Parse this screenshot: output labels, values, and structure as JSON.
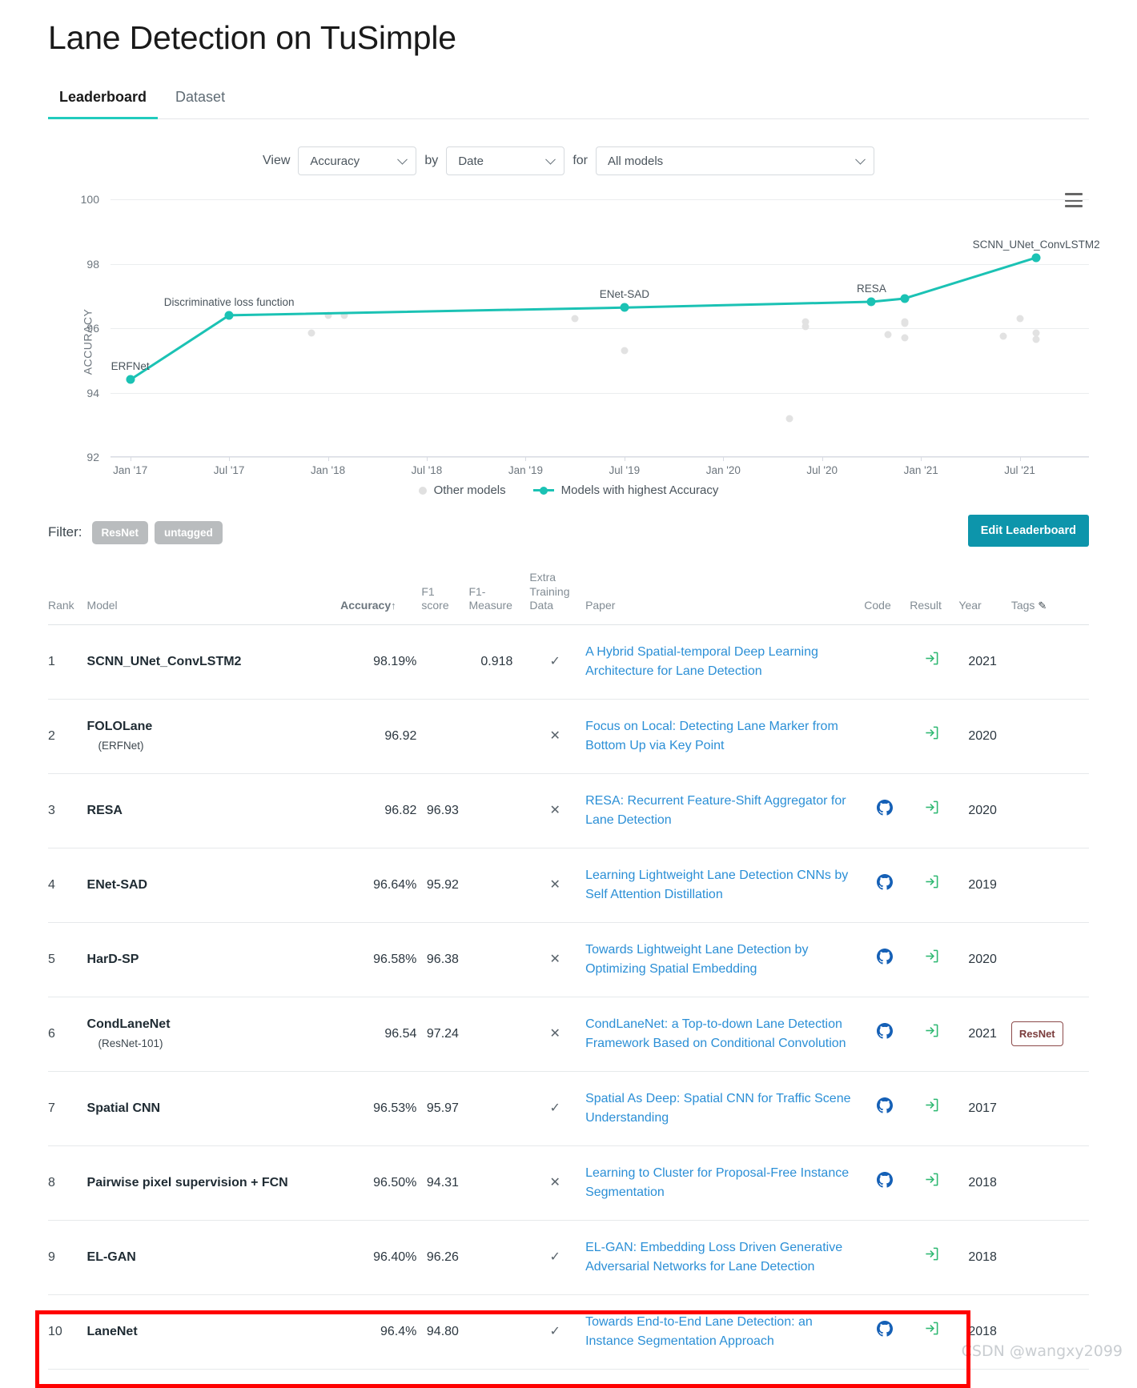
{
  "header": {
    "title": "Lane Detection on TuSimple",
    "tabs": [
      {
        "label": "Leaderboard",
        "active": true
      },
      {
        "label": "Dataset",
        "active": false
      }
    ]
  },
  "controls": {
    "view_label": "View",
    "by_label": "by",
    "for_label": "for",
    "metric_value": "Accuracy",
    "axis_value": "Date",
    "models_value": "All models"
  },
  "chart_data": {
    "type": "scatter",
    "title": "",
    "xlabel": "",
    "ylabel": "ACCURACY",
    "ylim": [
      92,
      100
    ],
    "yticks": [
      92,
      94,
      96,
      98,
      100
    ],
    "xticks": [
      "Jan '17",
      "Jul '17",
      "Jan '18",
      "Jul '18",
      "Jan '19",
      "Jul '19",
      "Jan '20",
      "Jul '20",
      "Jan '21",
      "Jul '21"
    ],
    "grid": true,
    "legend_position": "bottom",
    "legend": [
      "Other models",
      "Models with highest Accuracy"
    ],
    "series": [
      {
        "name": "Models with highest Accuracy",
        "color": "#1bc2b4",
        "points": [
          {
            "x": "2017-01",
            "y": 94.4,
            "label": "ERFNet"
          },
          {
            "x": "2017-07",
            "y": 96.4,
            "label": "Discriminative loss function"
          },
          {
            "x": "2019-07",
            "y": 96.64,
            "label": "ENet-SAD"
          },
          {
            "x": "2020-10",
            "y": 96.82,
            "label": "RESA"
          },
          {
            "x": "2020-12",
            "y": 96.92,
            "label": ""
          },
          {
            "x": "2021-08",
            "y": 98.19,
            "label": "SCNN_UNet_ConvLSTM2"
          }
        ]
      },
      {
        "name": "Other models",
        "color": "#e2e2e2",
        "points": [
          {
            "x": "2017-12",
            "y": 95.85
          },
          {
            "x": "2018-01",
            "y": 96.4
          },
          {
            "x": "2018-02",
            "y": 96.4
          },
          {
            "x": "2019-04",
            "y": 96.3
          },
          {
            "x": "2019-07",
            "y": 95.3
          },
          {
            "x": "2020-06",
            "y": 96.2
          },
          {
            "x": "2020-06",
            "y": 96.05
          },
          {
            "x": "2020-05",
            "y": 93.2
          },
          {
            "x": "2020-11",
            "y": 95.8
          },
          {
            "x": "2020-12",
            "y": 96.15
          },
          {
            "x": "2020-12",
            "y": 96.2
          },
          {
            "x": "2020-12",
            "y": 95.7
          },
          {
            "x": "2021-06",
            "y": 95.75
          },
          {
            "x": "2021-07",
            "y": 96.3
          },
          {
            "x": "2021-08",
            "y": 95.65
          },
          {
            "x": "2021-08",
            "y": 95.85
          }
        ]
      }
    ]
  },
  "filter": {
    "label": "Filter:",
    "tags": [
      "ResNet",
      "untagged"
    ],
    "edit_button": "Edit Leaderboard"
  },
  "table": {
    "columns": {
      "rank": "Rank",
      "model": "Model",
      "accuracy": "Accuracy",
      "sort_arrow": "↑",
      "f1_score": "F1 score",
      "f1_measure": "F1-Measure",
      "extra_training_data": "Extra Training Data",
      "paper": "Paper",
      "code": "Code",
      "result": "Result",
      "year": "Year",
      "tags": "Tags"
    },
    "rows": [
      {
        "rank": "1",
        "model": "SCNN_UNet_ConvLSTM2",
        "model_sub": "",
        "accuracy": "98.19%",
        "f1_score": "",
        "f1_measure": "0.918",
        "extra": "✓",
        "paper": "A Hybrid Spatial-temporal Deep Learning Architecture for Lane Detection",
        "code": false,
        "result": true,
        "year": "2021",
        "tags": []
      },
      {
        "rank": "2",
        "model": "FOLOLane",
        "model_sub": "(ERFNet)",
        "accuracy": "96.92",
        "f1_score": "",
        "f1_measure": "",
        "extra": "✕",
        "paper": "Focus on Local: Detecting Lane Marker from Bottom Up via Key Point",
        "code": false,
        "result": true,
        "year": "2020",
        "tags": []
      },
      {
        "rank": "3",
        "model": "RESA",
        "model_sub": "",
        "accuracy": "96.82",
        "f1_score": "96.93",
        "f1_measure": "",
        "extra": "✕",
        "paper": "RESA: Recurrent Feature-Shift Aggregator for Lane Detection",
        "code": true,
        "result": true,
        "year": "2020",
        "tags": []
      },
      {
        "rank": "4",
        "model": "ENet-SAD",
        "model_sub": "",
        "accuracy": "96.64%",
        "f1_score": "95.92",
        "f1_measure": "",
        "extra": "✕",
        "paper": "Learning Lightweight Lane Detection CNNs by Self Attention Distillation",
        "code": true,
        "result": true,
        "year": "2019",
        "tags": []
      },
      {
        "rank": "5",
        "model": "HarD-SP",
        "model_sub": "",
        "accuracy": "96.58%",
        "f1_score": "96.38",
        "f1_measure": "",
        "extra": "✕",
        "paper": "Towards Lightweight Lane Detection by Optimizing Spatial Embedding",
        "code": true,
        "result": true,
        "year": "2020",
        "tags": []
      },
      {
        "rank": "6",
        "model": "CondLaneNet",
        "model_sub": "(ResNet-101)",
        "accuracy": "96.54",
        "f1_score": "97.24",
        "f1_measure": "",
        "extra": "✕",
        "paper": "CondLaneNet: a Top-to-down Lane Detection Framework Based on Conditional Convolution",
        "code": true,
        "result": true,
        "year": "2021",
        "tags": [
          "ResNet"
        ]
      },
      {
        "rank": "7",
        "model": "Spatial CNN",
        "model_sub": "",
        "accuracy": "96.53%",
        "f1_score": "95.97",
        "f1_measure": "",
        "extra": "✓",
        "paper": "Spatial As Deep: Spatial CNN for Traffic Scene Understanding",
        "code": true,
        "result": true,
        "year": "2017",
        "tags": []
      },
      {
        "rank": "8",
        "model": "Pairwise pixel supervision + FCN",
        "model_sub": "",
        "accuracy": "96.50%",
        "f1_score": "94.31",
        "f1_measure": "",
        "extra": "✕",
        "paper": "Learning to Cluster for Proposal-Free Instance Segmentation",
        "code": true,
        "result": true,
        "year": "2018",
        "tags": []
      },
      {
        "rank": "9",
        "model": "EL-GAN",
        "model_sub": "",
        "accuracy": "96.40%",
        "f1_score": "96.26",
        "f1_measure": "",
        "extra": "✓",
        "paper": "EL-GAN: Embedding Loss Driven Generative Adversarial Networks for Lane Detection",
        "code": false,
        "result": true,
        "year": "2018",
        "tags": []
      },
      {
        "rank": "10",
        "model": "LaneNet",
        "model_sub": "",
        "accuracy": "96.4%",
        "f1_score": "94.80",
        "f1_measure": "",
        "extra": "✓",
        "paper": "Towards End-to-End Lane Detection: an Instance Segmentation Approach",
        "code": true,
        "result": true,
        "year": "2018",
        "tags": [],
        "highlighted": true
      }
    ]
  },
  "watermark": "CSDN @wangxy2099",
  "colors": {
    "accent": "#1bc2b4",
    "button": "#0d95ab",
    "link": "#2b8fd6",
    "highlight": "#ff0000"
  }
}
